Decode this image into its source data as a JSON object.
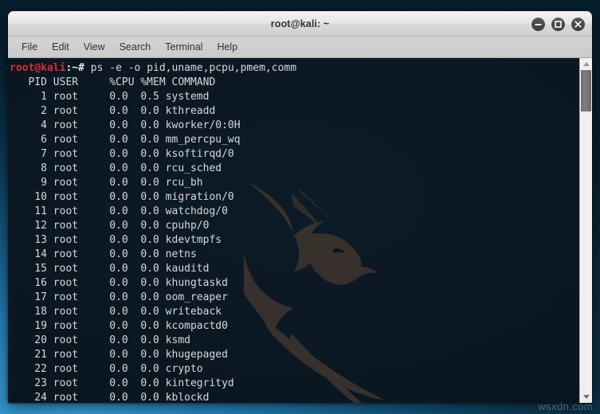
{
  "window": {
    "title": "root@kali: ~",
    "controls": [
      {
        "name": "minimize",
        "glyph": "minus"
      },
      {
        "name": "maximize",
        "glyph": "square"
      },
      {
        "name": "close",
        "glyph": "cross"
      }
    ]
  },
  "menubar": {
    "items": [
      "File",
      "Edit",
      "View",
      "Search",
      "Terminal",
      "Help"
    ]
  },
  "terminal": {
    "prompt": {
      "user_host": "root@kali",
      "path_sign": ":~# ",
      "command": "ps -e -o pid,uname,pcpu,pmem,comm"
    },
    "columns": [
      "PID",
      "USER",
      "%CPU",
      "%MEM",
      "COMMAND"
    ],
    "header_line": "   PID USER     %CPU %MEM COMMAND",
    "rows": [
      {
        "pid": "1",
        "user": "root",
        "cpu": "0.0",
        "mem": "0.5",
        "command": "systemd"
      },
      {
        "pid": "2",
        "user": "root",
        "cpu": "0.0",
        "mem": "0.0",
        "command": "kthreadd"
      },
      {
        "pid": "4",
        "user": "root",
        "cpu": "0.0",
        "mem": "0.0",
        "command": "kworker/0:0H"
      },
      {
        "pid": "6",
        "user": "root",
        "cpu": "0.0",
        "mem": "0.0",
        "command": "mm_percpu_wq"
      },
      {
        "pid": "7",
        "user": "root",
        "cpu": "0.0",
        "mem": "0.0",
        "command": "ksoftirqd/0"
      },
      {
        "pid": "8",
        "user": "root",
        "cpu": "0.0",
        "mem": "0.0",
        "command": "rcu_sched"
      },
      {
        "pid": "9",
        "user": "root",
        "cpu": "0.0",
        "mem": "0.0",
        "command": "rcu_bh"
      },
      {
        "pid": "10",
        "user": "root",
        "cpu": "0.0",
        "mem": "0.0",
        "command": "migration/0"
      },
      {
        "pid": "11",
        "user": "root",
        "cpu": "0.0",
        "mem": "0.0",
        "command": "watchdog/0"
      },
      {
        "pid": "12",
        "user": "root",
        "cpu": "0.0",
        "mem": "0.0",
        "command": "cpuhp/0"
      },
      {
        "pid": "13",
        "user": "root",
        "cpu": "0.0",
        "mem": "0.0",
        "command": "kdevtmpfs"
      },
      {
        "pid": "14",
        "user": "root",
        "cpu": "0.0",
        "mem": "0.0",
        "command": "netns"
      },
      {
        "pid": "15",
        "user": "root",
        "cpu": "0.0",
        "mem": "0.0",
        "command": "kauditd"
      },
      {
        "pid": "16",
        "user": "root",
        "cpu": "0.0",
        "mem": "0.0",
        "command": "khungtaskd"
      },
      {
        "pid": "17",
        "user": "root",
        "cpu": "0.0",
        "mem": "0.0",
        "command": "oom_reaper"
      },
      {
        "pid": "18",
        "user": "root",
        "cpu": "0.0",
        "mem": "0.0",
        "command": "writeback"
      },
      {
        "pid": "19",
        "user": "root",
        "cpu": "0.0",
        "mem": "0.0",
        "command": "kcompactd0"
      },
      {
        "pid": "20",
        "user": "root",
        "cpu": "0.0",
        "mem": "0.0",
        "command": "ksmd"
      },
      {
        "pid": "21",
        "user": "root",
        "cpu": "0.0",
        "mem": "0.0",
        "command": "khugepaged"
      },
      {
        "pid": "22",
        "user": "root",
        "cpu": "0.0",
        "mem": "0.0",
        "command": "crypto"
      },
      {
        "pid": "23",
        "user": "root",
        "cpu": "0.0",
        "mem": "0.0",
        "command": "kintegrityd"
      },
      {
        "pid": "24",
        "user": "root",
        "cpu": "0.0",
        "mem": "0.0",
        "command": "kblockd"
      }
    ]
  },
  "scrollbar": {
    "up_arrow": "scroll-up",
    "down_arrow": "scroll-down"
  },
  "overlay": {
    "site_watermark": "wsxdn.com"
  },
  "colors": {
    "prompt_red": "#d42e35",
    "terminal_bg": "#0a1620",
    "terminal_fg": "#d6d9dc",
    "titlebar_bg": "#e4e4e2",
    "desktop_accent": "#2383bd"
  }
}
